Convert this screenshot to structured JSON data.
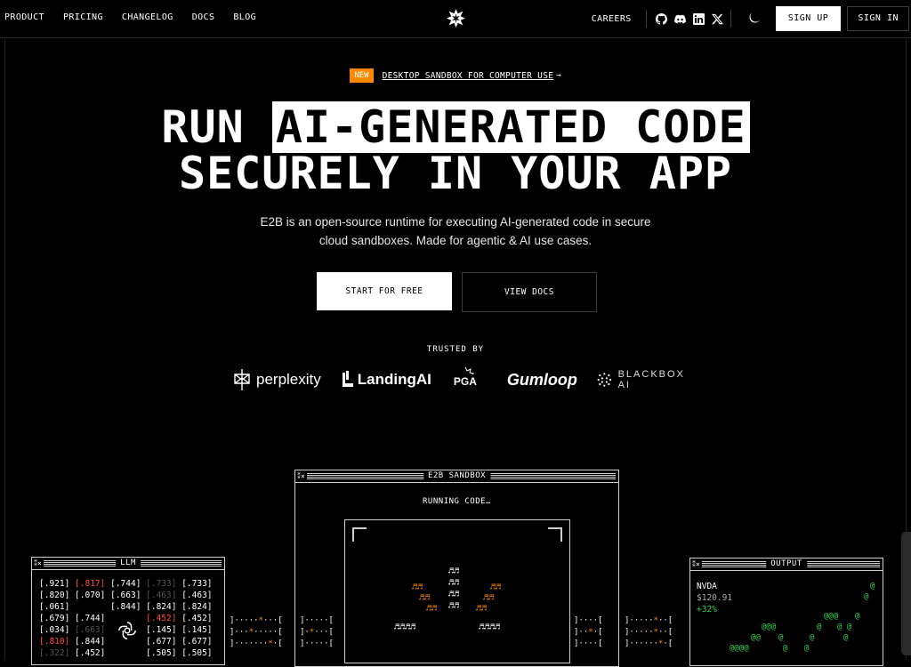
{
  "nav": {
    "links": [
      "PRODUCT",
      "PRICING",
      "CHANGELOG",
      "DOCS",
      "BLOG"
    ],
    "careers": "CAREERS",
    "sign_up": "SIGN UP",
    "sign_in": "SIGN IN",
    "social_icons": [
      "github-icon",
      "discord-icon",
      "linkedin-icon",
      "x-icon"
    ]
  },
  "badge": {
    "tag": "NEW",
    "text": "DESKTOP SANDBOX FOR COMPUTER USE",
    "arrow": "→"
  },
  "hero": {
    "line1_plain": "RUN ",
    "line1_highlight": "AI-GENERATED CODE",
    "line2": "SECURELY IN YOUR APP",
    "subtitle_1": "E2B is an open-source runtime for executing AI-generated code in secure",
    "subtitle_2": "cloud sandboxes. Made for agentic & AI use cases."
  },
  "cta": {
    "primary": "START FOR FREE",
    "secondary": "VIEW DOCS"
  },
  "trusted": {
    "label": "TRUSTED BY",
    "logos": [
      "perplexity",
      "LandingAI",
      "PGA",
      "Gumloop",
      "BLACKBOX AI"
    ]
  },
  "sandbox": {
    "title": "E2B SANDBOX",
    "controls": "⁑×",
    "status": "RUNNING CODE…"
  },
  "llm": {
    "title": "LLM",
    "controls": "⁑×",
    "rows": [
      [
        ".921",
        ".817",
        ".744",
        ".733",
        ".733"
      ],
      [
        ".820",
        ".070",
        ".663",
        ".463",
        ".463"
      ],
      [
        ".061",
        "",
        ".844",
        ".824",
        ".824"
      ],
      [
        ".679",
        ".744",
        "",
        ".452",
        ".452"
      ],
      [
        ".034",
        ".663",
        "",
        ".145",
        ".145"
      ],
      [
        ".810",
        ".844",
        "",
        ".677",
        ".677"
      ],
      [
        ".322",
        ".452",
        "",
        ".505",
        ".505"
      ]
    ]
  },
  "output": {
    "title": "OUTPUT",
    "controls": "⁑×",
    "ticker": "NVDA",
    "price": "$120.91",
    "change": "+32%"
  },
  "colors": {
    "accent": "#ff8800",
    "red": "#ff4a3a",
    "green": "#2fd04a"
  }
}
